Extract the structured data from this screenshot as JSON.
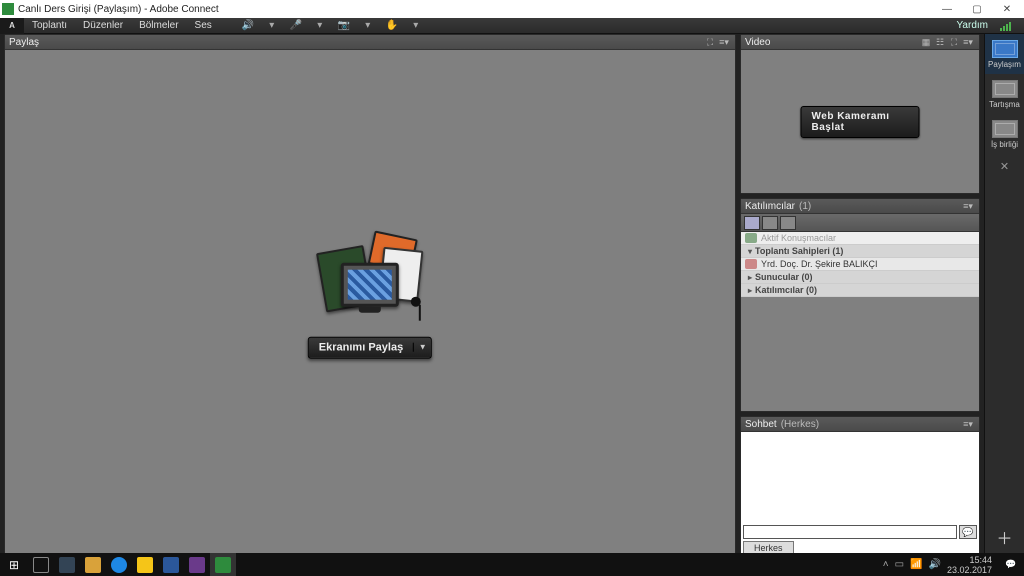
{
  "window": {
    "title": "Canlı Ders Girişi (Paylaşım) - Adobe Connect"
  },
  "menubar": {
    "items": [
      "Toplantı",
      "Düzenler",
      "Bölmeler",
      "Ses"
    ],
    "help": "Yardım"
  },
  "sidebar": {
    "layouts": [
      {
        "label": "Paylaşım",
        "active": true
      },
      {
        "label": "Tartışma",
        "active": false
      },
      {
        "label": "İş birliği",
        "active": false
      }
    ]
  },
  "pods": {
    "share": {
      "title": "Paylaş",
      "button_label": "Ekranımı Paylaş"
    },
    "video": {
      "title": "Video",
      "button_label": "Web Kameramı Başlat"
    },
    "participants": {
      "title": "Katılımcılar",
      "count_suffix": "(1)",
      "search_text": "Aktif Konuşmacılar",
      "sections": [
        {
          "label": "Toplantı Sahipleri (1)",
          "people": [
            "Yrd. Doç. Dr. Şekire BALIKÇI"
          ]
        },
        {
          "label": "Sunucular (0)",
          "people": []
        },
        {
          "label": "Katılımcılar (0)",
          "people": []
        }
      ]
    },
    "chat": {
      "title": "Sohbet",
      "scope": "(Herkes)",
      "tab": "Herkes",
      "input_placeholder": ""
    }
  },
  "taskbar": {
    "time": "15:44",
    "date": "23.02.2017"
  }
}
